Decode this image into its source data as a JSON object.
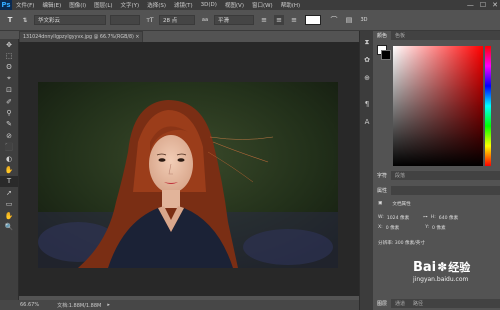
{
  "app": {
    "logo": "Ps"
  },
  "menu": {
    "items": [
      "文件(F)",
      "编辑(E)",
      "图像(I)",
      "图层(L)",
      "文字(Y)",
      "选择(S)",
      "滤镜(T)",
      "3D(D)",
      "视图(V)",
      "窗口(W)",
      "帮助(H)"
    ]
  },
  "window_controls": {
    "minimize": "—",
    "maximize": "☐",
    "close": "✕"
  },
  "options": {
    "font_family": "华文彩云",
    "font_style": "",
    "font_size": "28 点",
    "aa": "平滑",
    "tool_glyph": "T"
  },
  "toolbar": {
    "tools": [
      "✥",
      "⬚",
      "ʘ",
      "⌖",
      "⊡",
      "✐",
      "⚲",
      "✎",
      "⊘",
      "⬛",
      "◐",
      "✋",
      "T",
      "➚",
      "▭",
      "✋",
      "🔍"
    ]
  },
  "document": {
    "tab_title": "131024dnnyllgpzylgyyvx.jpg @ 66.7%(RGB/8) ×"
  },
  "status": {
    "zoom": "66.67%",
    "doc": "文档:1.88M/1.88M"
  },
  "panels": {
    "color_tabs": [
      "颜色",
      "色板"
    ],
    "char_tabs": [
      "字符",
      "段落"
    ],
    "prop_tabs": [
      "属性",
      ""
    ],
    "doc_props_title": "文档属性",
    "w_label": "W:",
    "w_value": "1024 像素",
    "h_label": "H:",
    "h_value": "640 像素",
    "x_label": "X:",
    "x_value": "0 像素",
    "y_label": "Y:",
    "y_value": "0 像素",
    "resolution": "分辨率: 300 像素/英寸",
    "bottom_tabs": [
      "图层",
      "通道",
      "路径"
    ]
  },
  "watermark": {
    "brand": "Bai",
    "brand2": "经验",
    "url": "jingyan.baidu.com"
  },
  "colors": {
    "accent": "#31a8ff",
    "bg": "#535353"
  }
}
